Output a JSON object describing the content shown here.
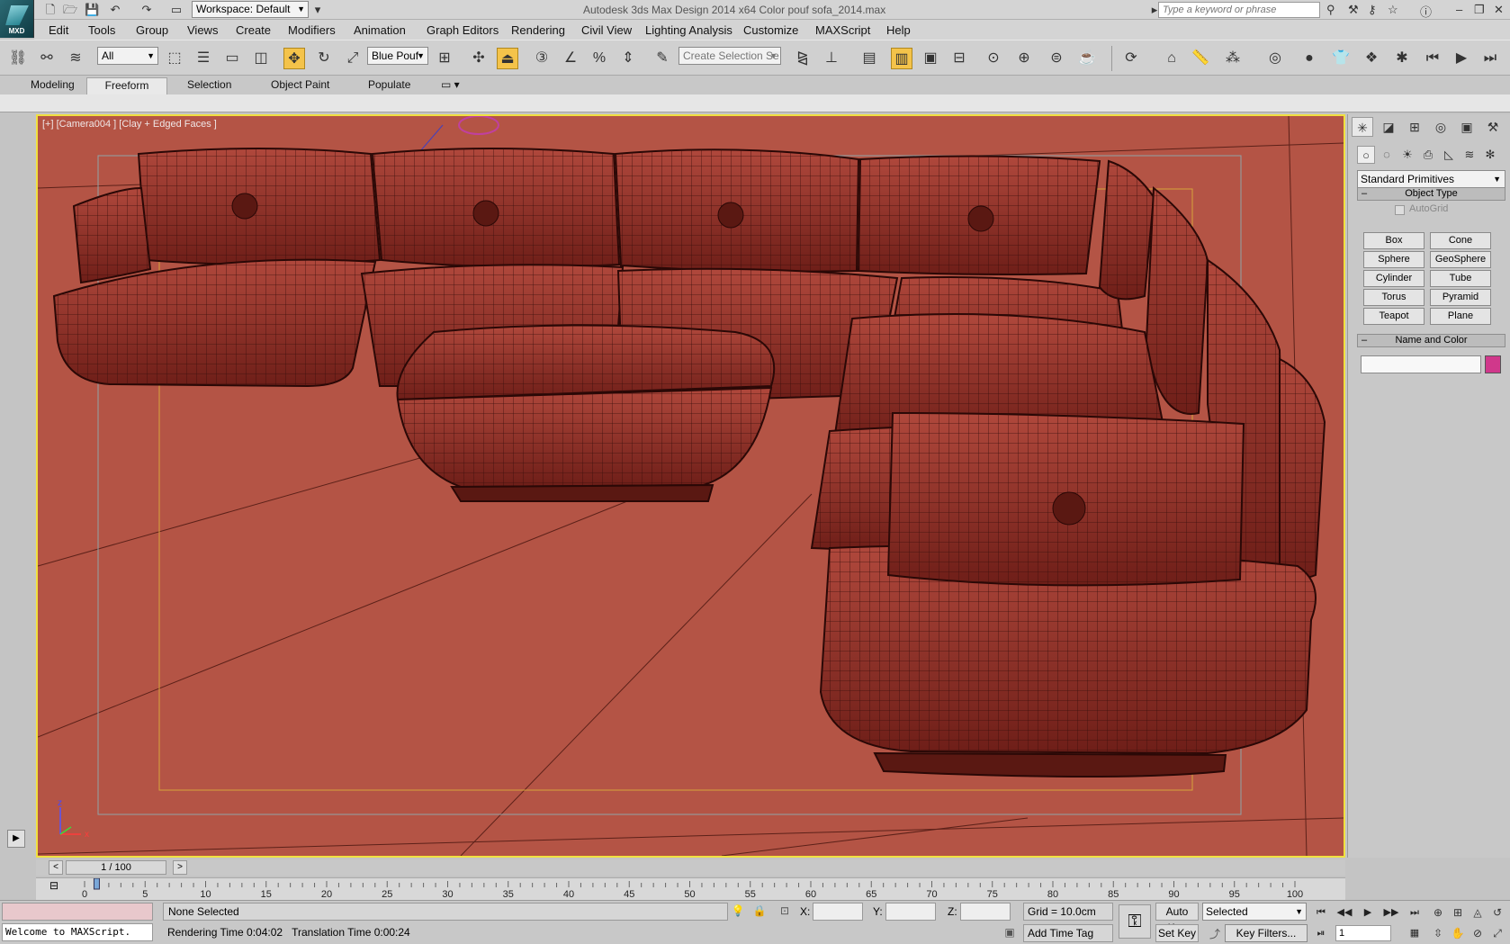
{
  "app": {
    "logo_label": "MXD",
    "title": "Autodesk 3ds Max Design 2014 x64      Color pouf sofa_2014.max",
    "workspace": "Workspace: Default",
    "search_placeholder": "Type a keyword or phrase"
  },
  "menu": [
    "Edit",
    "Tools",
    "Group",
    "Views",
    "Create",
    "Modifiers",
    "Animation",
    "Graph Editors",
    "Rendering",
    "Civil View",
    "Lighting Analysis",
    "Customize",
    "MAXScript",
    "Help"
  ],
  "toolbar": {
    "filter": "All",
    "selection_set": "Blue Pouf",
    "named_selection_placeholder": "Create Selection Se"
  },
  "ribbon_tabs": [
    "Modeling",
    "Freeform",
    "Selection",
    "Object Paint",
    "Populate"
  ],
  "ribbon_active": "Freeform",
  "viewport": {
    "label": "[+] [Camera004 ] [Clay + Edged Faces ]",
    "axis_z": "z",
    "axis_x": "x",
    "bg_color": "#b45445"
  },
  "command_panel": {
    "category": "Standard Primitives",
    "object_type_title": "Object Type",
    "autogrid": "AutoGrid",
    "buttons": [
      "Box",
      "Cone",
      "Sphere",
      "GeoSphere",
      "Cylinder",
      "Tube",
      "Torus",
      "Pyramid",
      "Teapot",
      "Plane"
    ],
    "name_color_title": "Name and Color",
    "swatch_color": "#d0388b"
  },
  "timeline": {
    "frame_counter": "1 / 100",
    "prev": "<",
    "next": ">",
    "ticks": [
      "0",
      "5",
      "10",
      "15",
      "20",
      "25",
      "30",
      "35",
      "40",
      "45",
      "50",
      "55",
      "60",
      "65",
      "70",
      "75",
      "80",
      "85",
      "90",
      "95",
      "100"
    ]
  },
  "status": {
    "maxscript": "Welcome to MAXScript.",
    "selection": "None Selected",
    "render_time": "Rendering Time  0:04:02",
    "translation_time": "Translation Time  0:00:24",
    "x_label": "X:",
    "y_label": "Y:",
    "z_label": "Z:",
    "grid": "Grid = 10.0cm",
    "add_time_tag": "Add Time Tag",
    "auto_key": "Auto Key",
    "set_key": "Set Key",
    "key_mode": "Selected",
    "key_filters": "Key Filters...",
    "current_frame": "1"
  }
}
